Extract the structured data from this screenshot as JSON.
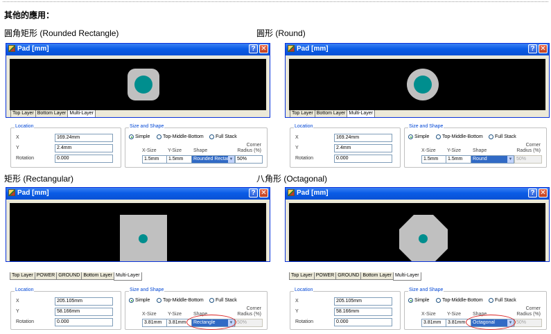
{
  "page": {
    "heading": "其他的應用："
  },
  "panels": [
    {
      "caption": "圓角矩形 (Rounded Rectangle)",
      "window_title": "Pad [mm]",
      "tabs": [
        "Top Layer",
        "Bottom Layer",
        "Multi-Layer"
      ],
      "location": {
        "title": "Location",
        "x_label": "X",
        "x_value": "169.24mm",
        "y_label": "Y",
        "y_value": "2.4mm",
        "rotation_label": "Rotation",
        "rotation_value": "0.000"
      },
      "size_shape": {
        "title": "Size and Shape",
        "radios": [
          "Simple",
          "Top-Middle-Bottom",
          "Full Stack"
        ],
        "selected": "Simple",
        "col_xsize": "X-Size",
        "col_ysize": "Y-Size",
        "col_shape": "Shape",
        "col_corner": "Corner Radius (%)",
        "xsize": "1.5mm",
        "ysize": "1.5mm",
        "shape": "Rounded Rectang",
        "corner": "50%"
      }
    },
    {
      "caption": "圓形 (Round)",
      "window_title": "Pad [mm]",
      "tabs": [
        "Top Layer",
        "Bottom Layer",
        "Multi-Layer"
      ],
      "location": {
        "title": "Location",
        "x_label": "X",
        "x_value": "169.24mm",
        "y_label": "Y",
        "y_value": "2.4mm",
        "rotation_label": "Rotation",
        "rotation_value": "0.000"
      },
      "size_shape": {
        "title": "Size and Shape",
        "radios": [
          "Simple",
          "Top-Middle-Bottom",
          "Full Stack"
        ],
        "selected": "Simple",
        "col_xsize": "X-Size",
        "col_ysize": "Y-Size",
        "col_shape": "Shape",
        "col_corner": "Corner Radius (%)",
        "xsize": "1.5mm",
        "ysize": "1.5mm",
        "shape": "Round",
        "corner": "50%"
      }
    },
    {
      "caption": "矩形 (Rectangular)",
      "window_title": "Pad [mm]",
      "tabs": [
        "Top Layer",
        "POWER",
        "GROUND",
        "Bottom Layer",
        "Multi-Layer"
      ],
      "location": {
        "title": "Location",
        "x_label": "X",
        "x_value": "205.105mm",
        "y_label": "Y",
        "y_value": "58.166mm",
        "rotation_label": "Rotation",
        "rotation_value": "0.000"
      },
      "size_shape": {
        "title": "Size and Shape",
        "radios": [
          "Simple",
          "Top-Middle-Bottom",
          "Full Stack"
        ],
        "selected": "Simple",
        "col_xsize": "X-Size",
        "col_ysize": "Y-Size",
        "col_shape": "Shape",
        "col_corner": "Corner Radius (%)",
        "xsize": "3.81mm",
        "ysize": "3.81mm",
        "shape": "Rectangle",
        "corner": "50%"
      }
    },
    {
      "caption": "八角形 (Octagonal)",
      "window_title": "Pad [mm]",
      "tabs": [
        "Top Layer",
        "POWER",
        "GROUND",
        "Bottom Layer",
        "Multi-Layer"
      ],
      "location": {
        "title": "Location",
        "x_label": "X",
        "x_value": "205.105mm",
        "y_label": "Y",
        "y_value": "58.166mm",
        "rotation_label": "Rotation",
        "rotation_value": "0.000"
      },
      "size_shape": {
        "title": "Size and Shape",
        "radios": [
          "Simple",
          "Top-Middle-Bottom",
          "Full Stack"
        ],
        "selected": "Simple",
        "col_xsize": "X-Size",
        "col_ysize": "Y-Size",
        "col_shape": "Shape",
        "col_corner": "Corner Radius (%)",
        "xsize": "3.81mm",
        "ysize": "3.81mm",
        "shape": "Octagonal",
        "corner": "50%"
      }
    }
  ],
  "icons": {
    "help": "help-icon",
    "close": "close-icon",
    "dropdown": "chevron-down-icon"
  }
}
